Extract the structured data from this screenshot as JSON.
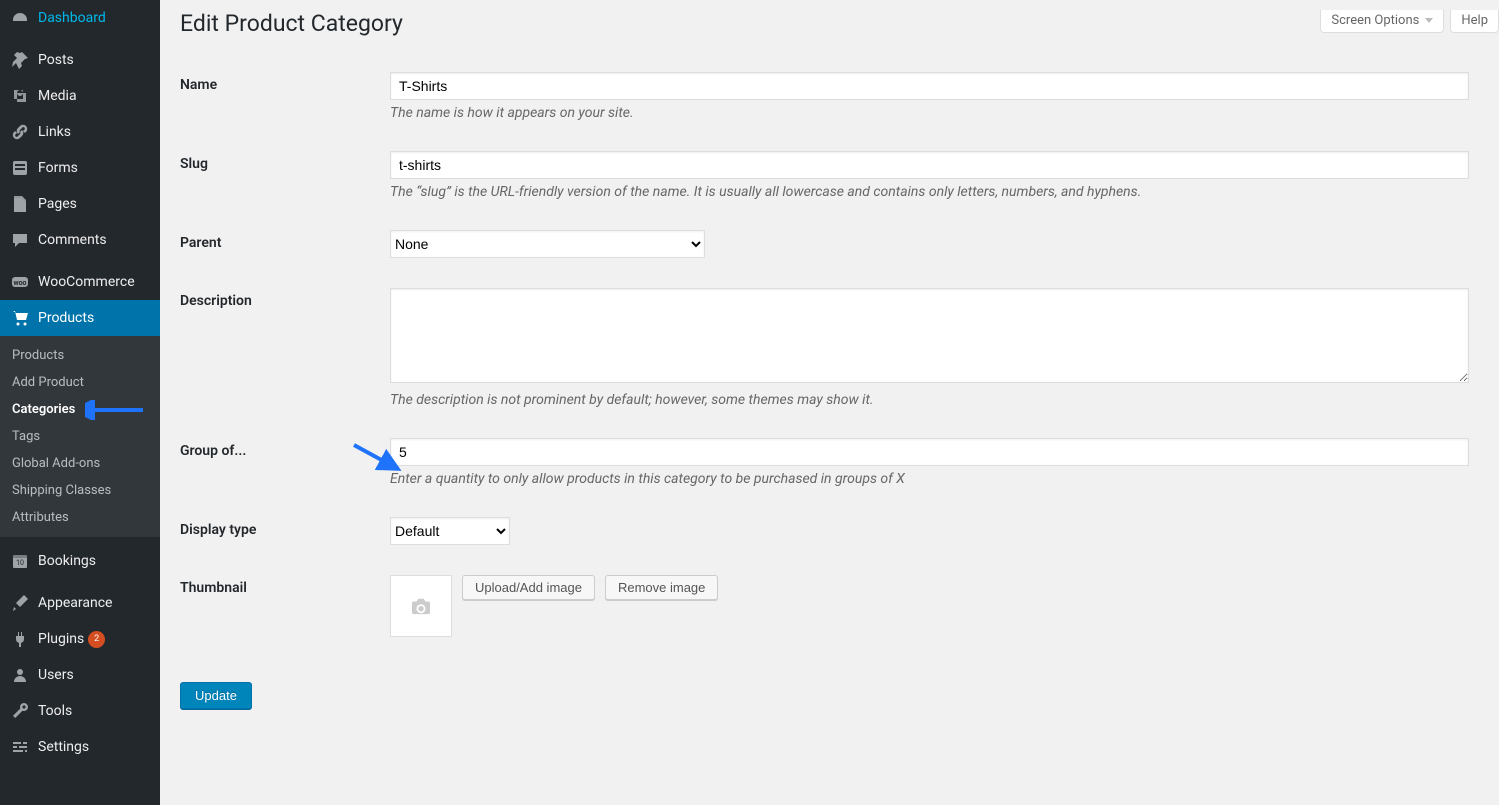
{
  "top": {
    "screen_options": "Screen Options",
    "help": "Help"
  },
  "sidebar": {
    "items": [
      {
        "label": "Dashboard",
        "name": "sidebar-item-dashboard",
        "icon": "dashboard"
      },
      {
        "label": "Posts",
        "name": "sidebar-item-posts",
        "icon": "pin"
      },
      {
        "label": "Media",
        "name": "sidebar-item-media",
        "icon": "media"
      },
      {
        "label": "Links",
        "name": "sidebar-item-links",
        "icon": "link"
      },
      {
        "label": "Forms",
        "name": "sidebar-item-forms",
        "icon": "form"
      },
      {
        "label": "Pages",
        "name": "sidebar-item-pages",
        "icon": "page"
      },
      {
        "label": "Comments",
        "name": "sidebar-item-comments",
        "icon": "comment"
      },
      {
        "label": "WooCommerce",
        "name": "sidebar-item-woocommerce",
        "icon": "woo"
      },
      {
        "label": "Products",
        "name": "sidebar-item-products",
        "icon": "cart",
        "current": true,
        "submenu": [
          {
            "label": "Products",
            "name": "submenu-products"
          },
          {
            "label": "Add Product",
            "name": "submenu-add-product"
          },
          {
            "label": "Categories",
            "name": "submenu-categories",
            "current": true
          },
          {
            "label": "Tags",
            "name": "submenu-tags"
          },
          {
            "label": "Global Add-ons",
            "name": "submenu-global-addons"
          },
          {
            "label": "Shipping Classes",
            "name": "submenu-shipping-classes"
          },
          {
            "label": "Attributes",
            "name": "submenu-attributes"
          }
        ]
      },
      {
        "label": "Bookings",
        "name": "sidebar-item-bookings",
        "icon": "calendar"
      },
      {
        "label": "Appearance",
        "name": "sidebar-item-appearance",
        "icon": "brush"
      },
      {
        "label": "Plugins",
        "name": "sidebar-item-plugins",
        "icon": "plug",
        "badge": "2"
      },
      {
        "label": "Users",
        "name": "sidebar-item-users",
        "icon": "user"
      },
      {
        "label": "Tools",
        "name": "sidebar-item-tools",
        "icon": "wrench"
      },
      {
        "label": "Settings",
        "name": "sidebar-item-settings",
        "icon": "sliders"
      }
    ]
  },
  "page": {
    "title": "Edit Product Category",
    "fields": {
      "name": {
        "label": "Name",
        "value": "T-Shirts",
        "desc": "The name is how it appears on your site."
      },
      "slug": {
        "label": "Slug",
        "value": "t-shirts",
        "desc": "The “slug” is the URL-friendly version of the name. It is usually all lowercase and contains only letters, numbers, and hyphens."
      },
      "parent": {
        "label": "Parent",
        "value": "None"
      },
      "description": {
        "label": "Description",
        "value": "",
        "desc": "The description is not prominent by default; however, some themes may show it."
      },
      "group_of": {
        "label": "Group of...",
        "value": "5",
        "desc": "Enter a quantity to only allow products in this category to be purchased in groups of X"
      },
      "display_type": {
        "label": "Display type",
        "value": "Default"
      },
      "thumbnail": {
        "label": "Thumbnail",
        "upload": "Upload/Add image",
        "remove": "Remove image"
      }
    },
    "submit": "Update"
  }
}
